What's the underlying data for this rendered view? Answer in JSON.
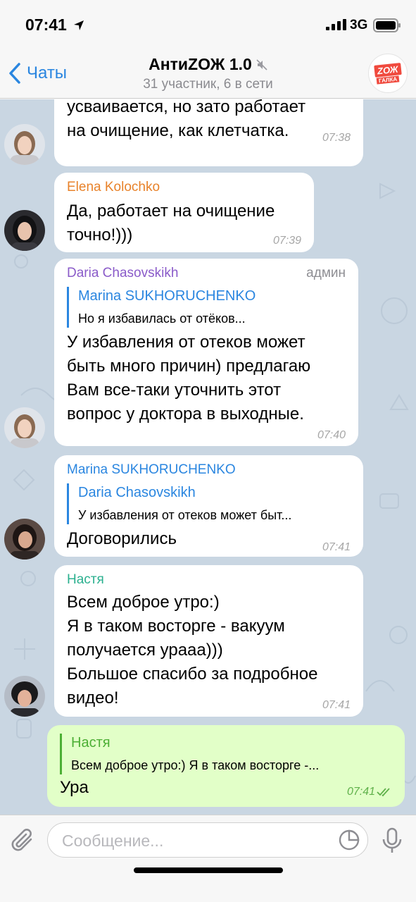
{
  "status_bar": {
    "time": "07:41",
    "network": "3G"
  },
  "header": {
    "back_label": "Чаты",
    "title": "АнтиZОЖ 1.0",
    "subtitle": "31 участник, 6 в сети",
    "avatar_logo_top": "ZОЖ",
    "avatar_logo_bottom": "ГАЛКА"
  },
  "messages": [
    {
      "lines": [
        "усваивается, но зато работает",
        "на очищение, как клетчатка."
      ],
      "time": "07:38"
    },
    {
      "sender": "Elena Kolochko",
      "sender_color": "#e8822a",
      "lines": [
        "Да, работает на очищение",
        "точно!)))"
      ],
      "time": "07:39"
    },
    {
      "sender": "Daria Chasovskikh",
      "sender_color": "#8a5bc9",
      "admin_label": "админ",
      "reply_name": "Marina SUKHORUCHENKO",
      "reply_text": "Но я избавилась от отёков...",
      "lines": [
        "У избавления от отеков может",
        "быть много причин) предлагаю",
        "Вам все-таки уточнить этот",
        "вопрос у доктора в выходные."
      ],
      "time": "07:40"
    },
    {
      "sender": "Marina SUKHORUCHENKO",
      "sender_color": "#2a86e0",
      "reply_name": "Daria Chasovskikh",
      "reply_text": "У избавления от отеков может быт...",
      "lines": [
        "Договорились"
      ],
      "time": "07:41"
    },
    {
      "sender": "Настя",
      "sender_color": "#2bb08f",
      "lines": [
        "Всем доброе утро:)",
        "Я в таком восторге - вакуум",
        "получается урааа)))",
        "Большое спасибо за подробное",
        "видео!"
      ],
      "time": "07:41"
    },
    {
      "outgoing": true,
      "reply_name": "Настя",
      "reply_text": "Всем доброе утро:) Я в таком восторге -...",
      "lines": [
        "Ура"
      ],
      "time": "07:41"
    }
  ],
  "input": {
    "placeholder": "Сообщение..."
  },
  "colors": {
    "accent": "#2a86e0",
    "chat_background": "#c9d6e2",
    "outgoing_bubble": "#e2ffc8",
    "logo_red": "#f04a3e"
  },
  "icons": [
    "location-arrow-icon",
    "signal-icon",
    "battery-icon",
    "back-chevron-icon",
    "mute-icon",
    "paperclip-icon",
    "sticker-icon",
    "microphone-icon",
    "read-checkmarks-icon"
  ]
}
